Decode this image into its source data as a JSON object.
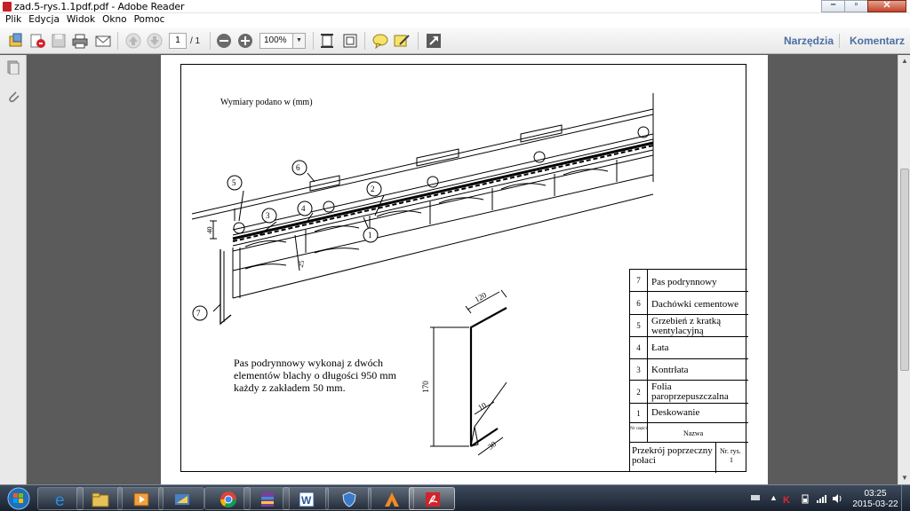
{
  "window": {
    "title": "zad.5-rys.1.1pdf.pdf - Adobe Reader",
    "minimize_glyph": "–",
    "maximize_glyph": "▫",
    "close_glyph": "✕"
  },
  "menu": {
    "items": [
      "Plik",
      "Edycja",
      "Widok",
      "Okno",
      "Pomoc"
    ]
  },
  "toolbar": {
    "page_current": "1",
    "page_total": "/ 1",
    "zoom": "100%",
    "tools_label": "Narzędzia",
    "comment_label": "Komentarz"
  },
  "drawing": {
    "units_note": "Wymiary podano w (mm)",
    "callouts": [
      "6",
      "5",
      "2",
      "3",
      "4",
      "1",
      "7"
    ],
    "dim_40": "40",
    "dim_25": "25",
    "dim_120": "120",
    "dim_170": "170",
    "dim_10": "10",
    "dim_30": "30",
    "note_line1": "Pas podrynnowy wykonaj z dwóch",
    "note_line2": "elementów blachy o długości 950 mm",
    "note_line3": "każdy z zakładem 50 mm."
  },
  "legend": {
    "rows": [
      {
        "num": "7",
        "name": "Pas podrynnowy"
      },
      {
        "num": "6",
        "name": "Dachówki cementowe"
      },
      {
        "num": "5",
        "name": "Grzebień z kratką wentylacyjną"
      },
      {
        "num": "4",
        "name": "Łata"
      },
      {
        "num": "3",
        "name": "Kontrłata"
      },
      {
        "num": "2",
        "name": "Folia paroprzepuszczalna"
      },
      {
        "num": "1",
        "name": "Deskowanie"
      }
    ],
    "header_num": "Nr części",
    "header_name": "Nazwa",
    "title": "Przekrój poprzeczny połaci",
    "sheet_label": "Nr. rys.",
    "sheet_num": "1"
  },
  "taskbar": {
    "time": "03:25",
    "date": "2015-03-22"
  }
}
